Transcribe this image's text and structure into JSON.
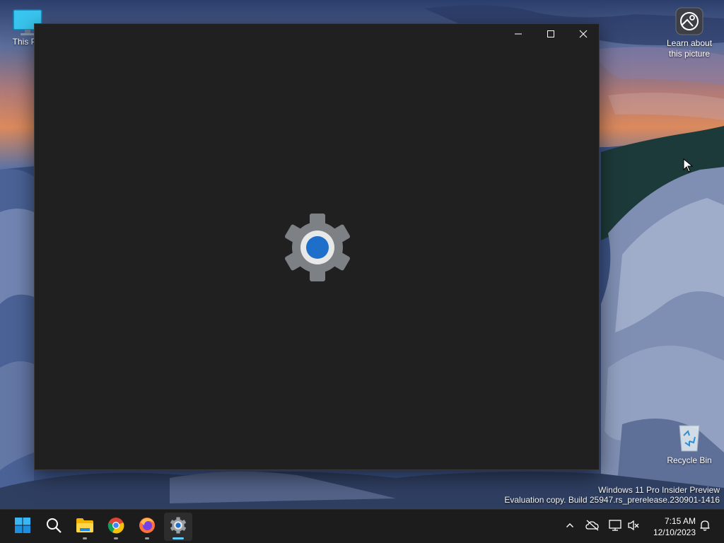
{
  "desktop": {
    "icons": {
      "this_pc": {
        "label": "This PC"
      },
      "learn_picture": {
        "label": "Learn about this picture"
      },
      "recycle_bin": {
        "label": "Recycle Bin"
      }
    },
    "watermark": {
      "line1": "Windows 11 Pro Insider Preview",
      "line2": "Evaluation copy. Build 25947.rs_prerelease.230901-1416"
    }
  },
  "window": {
    "app": "Settings",
    "splash_icon": "settings-gear-icon",
    "accent_color": "#1e6fc9",
    "background_color": "#202020"
  },
  "taskbar": {
    "apps": [
      {
        "name": "Start",
        "icon": "windows-logo-icon"
      },
      {
        "name": "Search",
        "icon": "search-icon"
      },
      {
        "name": "File Explorer",
        "icon": "folder-icon"
      },
      {
        "name": "Google Chrome",
        "icon": "chrome-icon"
      },
      {
        "name": "Firefox",
        "icon": "firefox-icon"
      },
      {
        "name": "Settings",
        "icon": "settings-gear-icon",
        "active": true
      }
    ],
    "tray": {
      "icons": [
        "chevron-up-icon",
        "onedrive-offline-icon",
        "network-icon",
        "volume-muted-icon",
        "notification-bell-icon"
      ]
    },
    "clock": {
      "time": "7:15 AM",
      "date": "12/10/2023"
    }
  }
}
